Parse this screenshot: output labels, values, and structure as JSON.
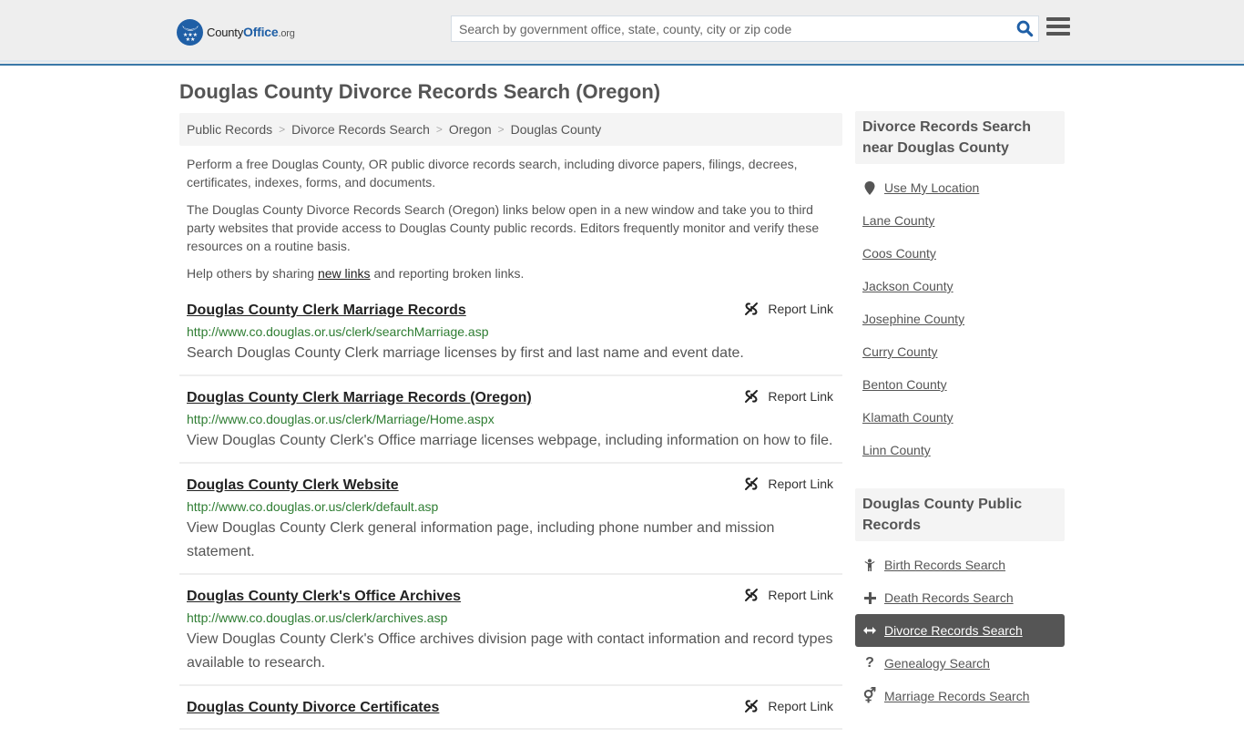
{
  "header": {
    "logo": {
      "county": "County",
      "office": "Office",
      "org": ".org"
    },
    "search": {
      "placeholder": "Search by government office, state, county, city or zip code",
      "value": ""
    },
    "colors": {
      "brand": "#1f5fa6",
      "accent_line": "#3a78a8"
    }
  },
  "page": {
    "title": "Douglas County Divorce Records Search (Oregon)"
  },
  "breadcrumb": [
    {
      "label": "Public Records"
    },
    {
      "label": "Divorce Records Search"
    },
    {
      "label": "Oregon"
    },
    {
      "label": "Douglas County"
    }
  ],
  "intro": {
    "p1": "Perform a free Douglas County, OR public divorce records search, including divorce papers, filings, decrees, certificates, indexes, forms, and documents.",
    "p2": "The Douglas County Divorce Records Search (Oregon) links below open in a new window and take you to third party websites that provide access to Douglas County public records. Editors frequently monitor and verify these resources on a routine basis.",
    "p3_before": "Help others by sharing ",
    "p3_link": "new links",
    "p3_after": " and reporting broken links."
  },
  "results": [
    {
      "title": "Douglas County Clerk Marriage Records",
      "url": "http://www.co.douglas.or.us/clerk/searchMarriage.asp",
      "description": "Search Douglas County Clerk marriage licenses by first and last name and event date.",
      "report_label": "Report Link"
    },
    {
      "title": "Douglas County Clerk Marriage Records (Oregon)",
      "url": "http://www.co.douglas.or.us/clerk/Marriage/Home.aspx",
      "description": "View Douglas County Clerk's Office marriage licenses webpage, including information on how to file.",
      "report_label": "Report Link"
    },
    {
      "title": "Douglas County Clerk Website",
      "url": "http://www.co.douglas.or.us/clerk/default.asp",
      "description": "View Douglas County Clerk general information page, including phone number and mission statement.",
      "report_label": "Report Link"
    },
    {
      "title": "Douglas County Clerk's Office Archives",
      "url": "http://www.co.douglas.or.us/clerk/archives.asp",
      "description": "View Douglas County Clerk's Office archives division page with contact information and record types available to research.",
      "report_label": "Report Link"
    },
    {
      "title": "Douglas County Divorce Certificates",
      "url": "",
      "description": "",
      "report_label": "Report Link"
    }
  ],
  "sidebar": {
    "nearby": {
      "heading": "Divorce Records Search near Douglas County",
      "use_location": {
        "label": "Use My Location",
        "icon": "map-marker-icon"
      },
      "counties": [
        "Lane County",
        "Coos County",
        "Jackson County",
        "Josephine County",
        "Curry County",
        "Benton County",
        "Klamath County",
        "Linn County"
      ]
    },
    "public_records": {
      "heading": "Douglas County Public Records",
      "items": [
        {
          "label": "Birth Records Search",
          "icon": "child-icon",
          "glyph": "†",
          "active": false
        },
        {
          "label": "Death Records Search",
          "icon": "plus-icon",
          "glyph": "+",
          "active": false
        },
        {
          "label": "Divorce Records Search",
          "icon": "arrows-horizontal-icon",
          "glyph": "↔",
          "active": true
        },
        {
          "label": "Genealogy Search",
          "icon": "question-icon",
          "glyph": "?",
          "active": false
        },
        {
          "label": "Marriage Records Search",
          "icon": "venus-mars-icon",
          "glyph": "⚥",
          "active": false
        }
      ]
    }
  }
}
